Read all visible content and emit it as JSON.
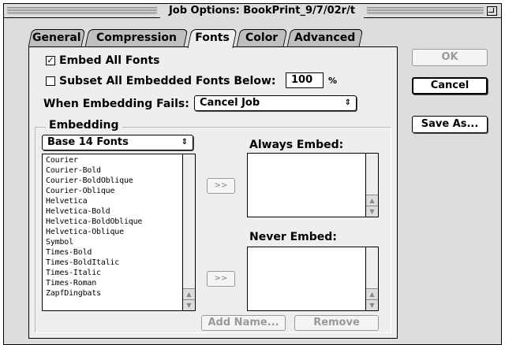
{
  "window": {
    "title": "Job Options: BookPrint_9/7/02r/t"
  },
  "tabs": [
    {
      "label": "General"
    },
    {
      "label": "Compression"
    },
    {
      "label": "Fonts"
    },
    {
      "label": "Color"
    },
    {
      "label": "Advanced"
    }
  ],
  "active_tab": "Fonts",
  "options": {
    "embed_all_fonts": {
      "label": "Embed All Fonts",
      "checked": true,
      "mark": "✓"
    },
    "subset_fonts": {
      "label": "Subset All Embedded Fonts Below:",
      "checked": false,
      "value": "100",
      "unit": "%"
    },
    "when_fails": {
      "label": "When Embedding Fails:",
      "value": "Cancel Job"
    }
  },
  "embedding": {
    "title": "Embedding",
    "source_popup": "Base 14 Fonts",
    "font_list": [
      "Courier",
      "Courier-Bold",
      "Courier-BoldOblique",
      "Courier-Oblique",
      "Helvetica",
      "Helvetica-Bold",
      "Helvetica-BoldOblique",
      "Helvetica-Oblique",
      "Symbol",
      "Times-Bold",
      "Times-BoldItalic",
      "Times-Italic",
      "Times-Roman",
      "ZapfDingbats"
    ],
    "move_label": ">>",
    "always_embed": {
      "title": "Always Embed:"
    },
    "never_embed": {
      "title": "Never Embed:"
    },
    "add_name_label": "Add Name...",
    "remove_label": "Remove"
  },
  "buttons": {
    "ok": "OK",
    "cancel": "Cancel",
    "save_as": "Save As..."
  },
  "icons": {
    "popup_arrows": "⇕",
    "scroll_up": "▲",
    "scroll_down": "▼"
  },
  "colors": {
    "window_bg": "#dddddd",
    "panel_bg": "#eeeeee",
    "disabled_text": "#999999"
  }
}
